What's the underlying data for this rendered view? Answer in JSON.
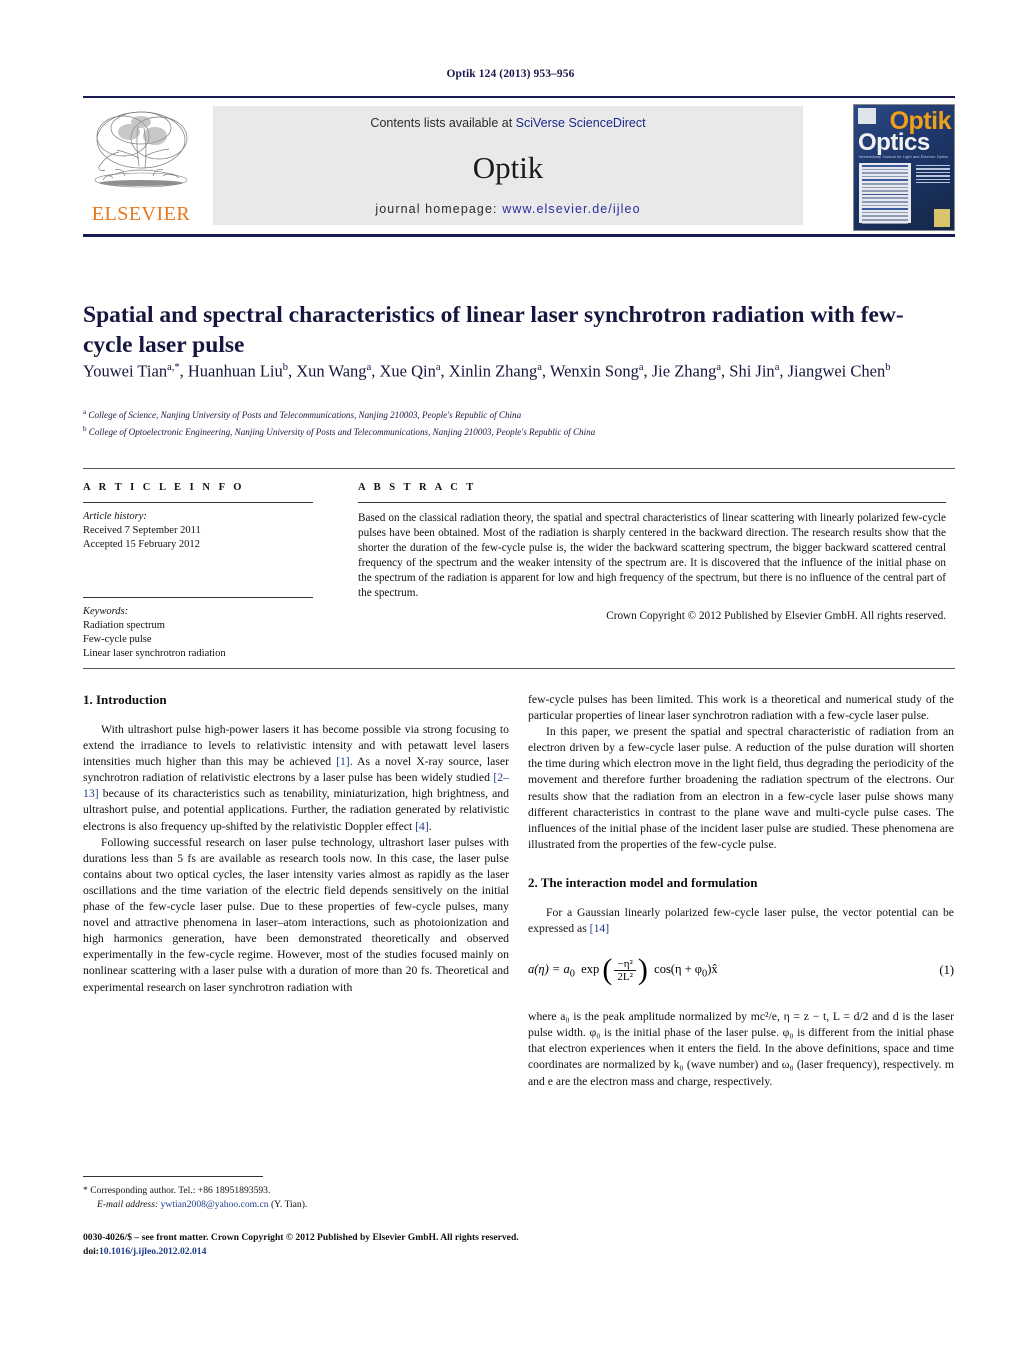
{
  "running_head": "Optik 124 (2013) 953–956",
  "masthead": {
    "publisher": "ELSEVIER",
    "contents_prefix": "Contents lists available at ",
    "contents_link": "SciVerse ScienceDirect",
    "journal_name": "Optik",
    "homepage_prefix": "journal homepage: ",
    "homepage_link": "www.elsevier.de/ijleo",
    "cover": {
      "title_top": "Optik",
      "title_bottom": "Optics",
      "subtitle": "International Journal for Light and Electron Optics"
    }
  },
  "article": {
    "title": "Spatial and spectral characteristics of linear laser synchrotron radiation with few-cycle laser pulse",
    "authors_html": "Youwei Tian<sup>a,*</sup>, Huanhuan Liu<sup>b</sup>, Xun Wang<sup>a</sup>, Xue Qin<sup>a</sup>, Xinlin Zhang<sup>a</sup>, Wenxin Song<sup>a</sup>, Jie Zhang<sup>a</sup>, Shi Jin<sup>a</sup>, Jiangwei Chen<sup>b</sup>",
    "affiliation_a": "College of Science, Nanjing University of Posts and Telecommunications, Nanjing 210003, People's Republic of China",
    "affiliation_b": "College of Optoelectronic Engineering, Nanjing University of Posts and Telecommunications, Nanjing 210003, People's Republic of China"
  },
  "info": {
    "heading": "A R T I C L E    I N F O",
    "history_label": "Article history:",
    "received": "Received 7 September 2011",
    "accepted": "Accepted 15 February 2012",
    "keywords_label": "Keywords:",
    "keyword_1": "Radiation spectrum",
    "keyword_2": "Few-cycle pulse",
    "keyword_3": "Linear laser synchrotron radiation"
  },
  "abstract": {
    "heading": "A B S T R A C T",
    "text": "Based on the classical radiation theory, the spatial and spectral characteristics of linear scattering with linearly polarized few-cycle pulses have been obtained. Most of the radiation is sharply centered in the backward direction. The research results show that the shorter the duration of the few-cycle pulse is, the wider the backward scattering spectrum, the bigger backward scattered central frequency of the spectrum and the weaker intensity of the spectrum are. It is discovered that the influence of the initial phase on the spectrum of the radiation is apparent for low and high frequency of the spectrum, but there is no influence of the central part of the spectrum.",
    "copyright": "Crown Copyright © 2012 Published by Elsevier GmbH. All rights reserved."
  },
  "body": {
    "section1_heading": "1. Introduction",
    "section1_p1_a": "With ultrashort pulse high-power lasers it has become possible via strong focusing to extend the irradiance to levels to relativistic intensity and with petawatt level lasers intensities much higher than this may be achieved ",
    "ref1": "[1]",
    "section1_p1_b": ". As a novel X-ray source, laser synchrotron radiation of relativistic electrons by a laser pulse has been widely studied ",
    "ref2": "[2–13]",
    "section1_p1_c": " because of its characteristics such as tenability, miniaturization, high brightness, and ultrashort pulse, and potential applications. Further, the radiation generated by relativistic electrons is also frequency up-shifted by the relativistic Doppler effect ",
    "ref4": "[4]",
    "section1_p1_d": ".",
    "section1_p2": "Following successful research on laser pulse technology, ultrashort laser pulses with durations less than 5 fs are available as research tools now. In this case, the laser pulse contains about two optical cycles, the laser intensity varies almost as rapidly as the laser oscillations and the time variation of the electric field depends sensitively on the initial phase of the few-cycle laser pulse. Due to these properties of few-cycle pulses, many novel and attractive phenomena in laser–atom interactions, such as photoionization and high harmonics generation, have been demonstrated theoretically and observed experimentally in the few-cycle regime. However, most of the studies focused mainly on nonlinear scattering with a laser pulse with a duration of more than 20 fs. Theoretical and experimental research on laser synchrotron radiation with",
    "section1_p2_cont": "few-cycle pulses has been limited. This work is a theoretical and numerical study of the particular properties of linear laser synchrotron radiation with a few-cycle laser pulse.",
    "section1_p3": "In this paper, we present the spatial and spectral characteristic of radiation from an electron driven by a few-cycle laser pulse. A reduction of the pulse duration will shorten the time during which electron move in the light field, thus degrading the periodicity of the movement and therefore further broadening the radiation spectrum of the electrons. Our results show that the radiation from an electron in a few-cycle laser pulse shows many different characteristics in contrast to the plane wave and multi-cycle pulse cases. The influences of the initial phase of the incident laser pulse are studied. These phenomena are illustrated from the properties of the few-cycle pulse.",
    "section2_heading": "2. The interaction model and formulation",
    "section2_p1_a": "For a Gaussian linearly polarized few-cycle laser pulse, the vector potential can be expressed as ",
    "ref14": "[14]",
    "equation_1": {
      "lhs": "a(η) = a",
      "lhs_sub": "0",
      "exp": "exp",
      "num": "−η²",
      "den": "2L²",
      "cos": "cos(η + φ",
      "cos_sub": "0",
      "cos_tail": ")x̂",
      "number": "(1)"
    },
    "section2_p2": "where a₀ is the peak amplitude normalized by mc²/e, η = z − t, L = d/2 and d is the laser pulse width. φ₀ is the initial phase of the laser pulse. φ₀ is different from the initial phase that electron experiences when it enters the field. In the above definitions, space and time coordinates are normalized by k₀ (wave number) and ω₀ (laser frequency), respectively. m and e are the electron mass and charge, respectively."
  },
  "footnotes": {
    "corresponding": "* Corresponding author. Tel.: +86 18951893593.",
    "email_label": "E-mail address:",
    "email": "ywtian2008@yahoo.com.cn",
    "email_attrib": "(Y. Tian).",
    "imprint": "0030-4026/$ – see front matter. Crown Copyright © 2012 Published by Elsevier GmbH. All rights reserved.",
    "doi_label": "doi:",
    "doi": "10.1016/j.ijleo.2012.02.014"
  }
}
